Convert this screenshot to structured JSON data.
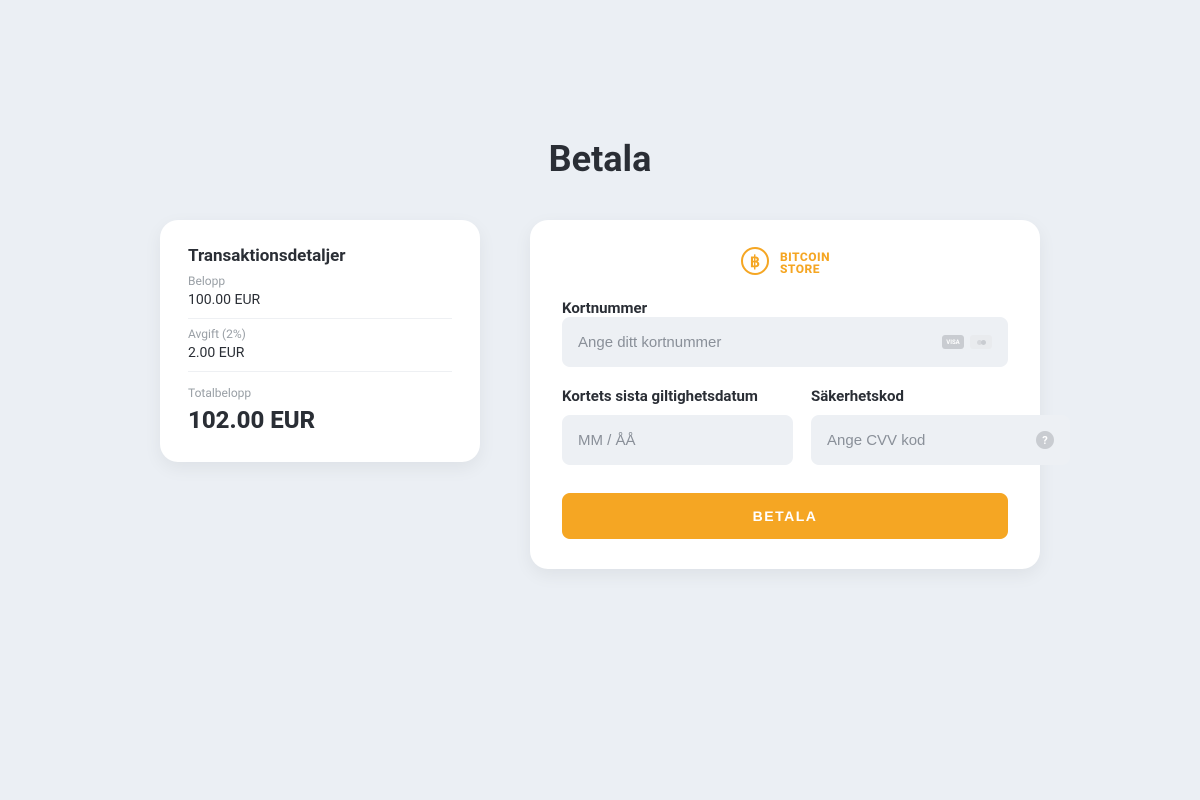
{
  "page": {
    "title": "Betala"
  },
  "colors": {
    "accent": "#f5a623",
    "bg": "#ebeff4"
  },
  "details": {
    "title": "Transaktionsdetaljer",
    "amount_label": "Belopp",
    "amount_value": "100.00 EUR",
    "fee_label": "Avgift (2%)",
    "fee_value": "2.00 EUR",
    "total_label": "Totalbelopp",
    "total_value": "102.00 EUR"
  },
  "brand": {
    "line1": "BITCOIN",
    "line2": "STORE"
  },
  "form": {
    "card_number": {
      "label": "Kortnummer",
      "placeholder": "Ange ditt kortnummer",
      "value": ""
    },
    "expiry": {
      "label": "Kortets sista giltighetsdatum",
      "placeholder": "MM / ÅÅ",
      "value": ""
    },
    "cvv": {
      "label": "Säkerhetskod",
      "placeholder": "Ange CVV kod",
      "value": ""
    },
    "submit_label": "BETALA"
  },
  "icons": {
    "visa_label": "VISA",
    "help_glyph": "?"
  }
}
